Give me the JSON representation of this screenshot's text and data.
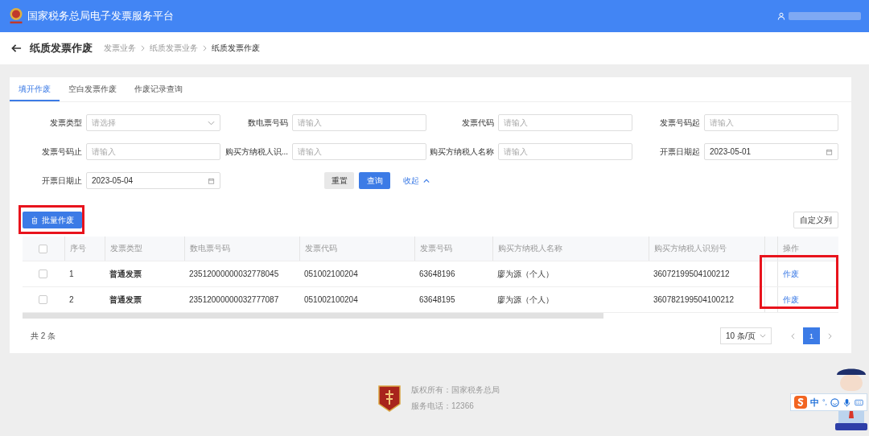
{
  "header": {
    "title": "国家税务总局电子发票服务平台"
  },
  "page": {
    "title": "纸质发票作废",
    "breadcrumb": [
      "发票业务",
      "纸质发票业务",
      "纸质发票作废"
    ]
  },
  "tabs": [
    {
      "label": "填开作废",
      "selected": true
    },
    {
      "label": "空白发票作废",
      "selected": false
    },
    {
      "label": "作废记录查询",
      "selected": false
    }
  ],
  "filters": [
    {
      "label": "发票类型",
      "kind": "select",
      "placeholder": "请选择"
    },
    {
      "label": "数电票号码",
      "kind": "text",
      "placeholder": "请输入"
    },
    {
      "label": "发票代码",
      "kind": "text",
      "placeholder": "请输入"
    },
    {
      "label": "发票号码起",
      "kind": "text",
      "placeholder": "请输入"
    },
    {
      "label": "发票号码止",
      "kind": "text",
      "placeholder": "请输入"
    },
    {
      "label": "购买方纳税人识...",
      "kind": "text",
      "placeholder": "请输入"
    },
    {
      "label": "购买方纳税人名称",
      "kind": "text",
      "placeholder": "请输入"
    },
    {
      "label": "开票日期起",
      "kind": "date",
      "value": "2023-05-01"
    },
    {
      "label": "开票日期止",
      "kind": "date",
      "value": "2023-05-04"
    }
  ],
  "actions": {
    "reset": "重置",
    "query": "查询",
    "collapse": "收起"
  },
  "batch_button": "批量作废",
  "columns_button": "自定义列",
  "table": {
    "columns": [
      "序号",
      "发票类型",
      "数电票号码",
      "发票代码",
      "发票号码",
      "购买方纳税人名称",
      "购买方纳税人识别号",
      "操作"
    ],
    "select_all_checked": false,
    "rows": [
      {
        "checked": false,
        "cells": [
          "1",
          "普通发票",
          "23512000000032778045",
          "051002100204",
          "63648196",
          "廖为源（个人）",
          "36072199504100212"
        ],
        "action": "作废"
      },
      {
        "checked": false,
        "cells": [
          "2",
          "普通发票",
          "23512000000032777087",
          "051002100204",
          "63648195",
          "廖为源（个人）",
          "360782199504100212"
        ],
        "action": "作废"
      }
    ]
  },
  "pagination": {
    "total": "共 2 条",
    "page_size": "10 条/页",
    "pages": [
      {
        "label": "1",
        "selected": true
      }
    ]
  },
  "footer": {
    "lines": [
      "版权所有：国家税务总局",
      "服务电话：12366"
    ]
  },
  "ime": {
    "mode": "中",
    "punct": "°,"
  }
}
